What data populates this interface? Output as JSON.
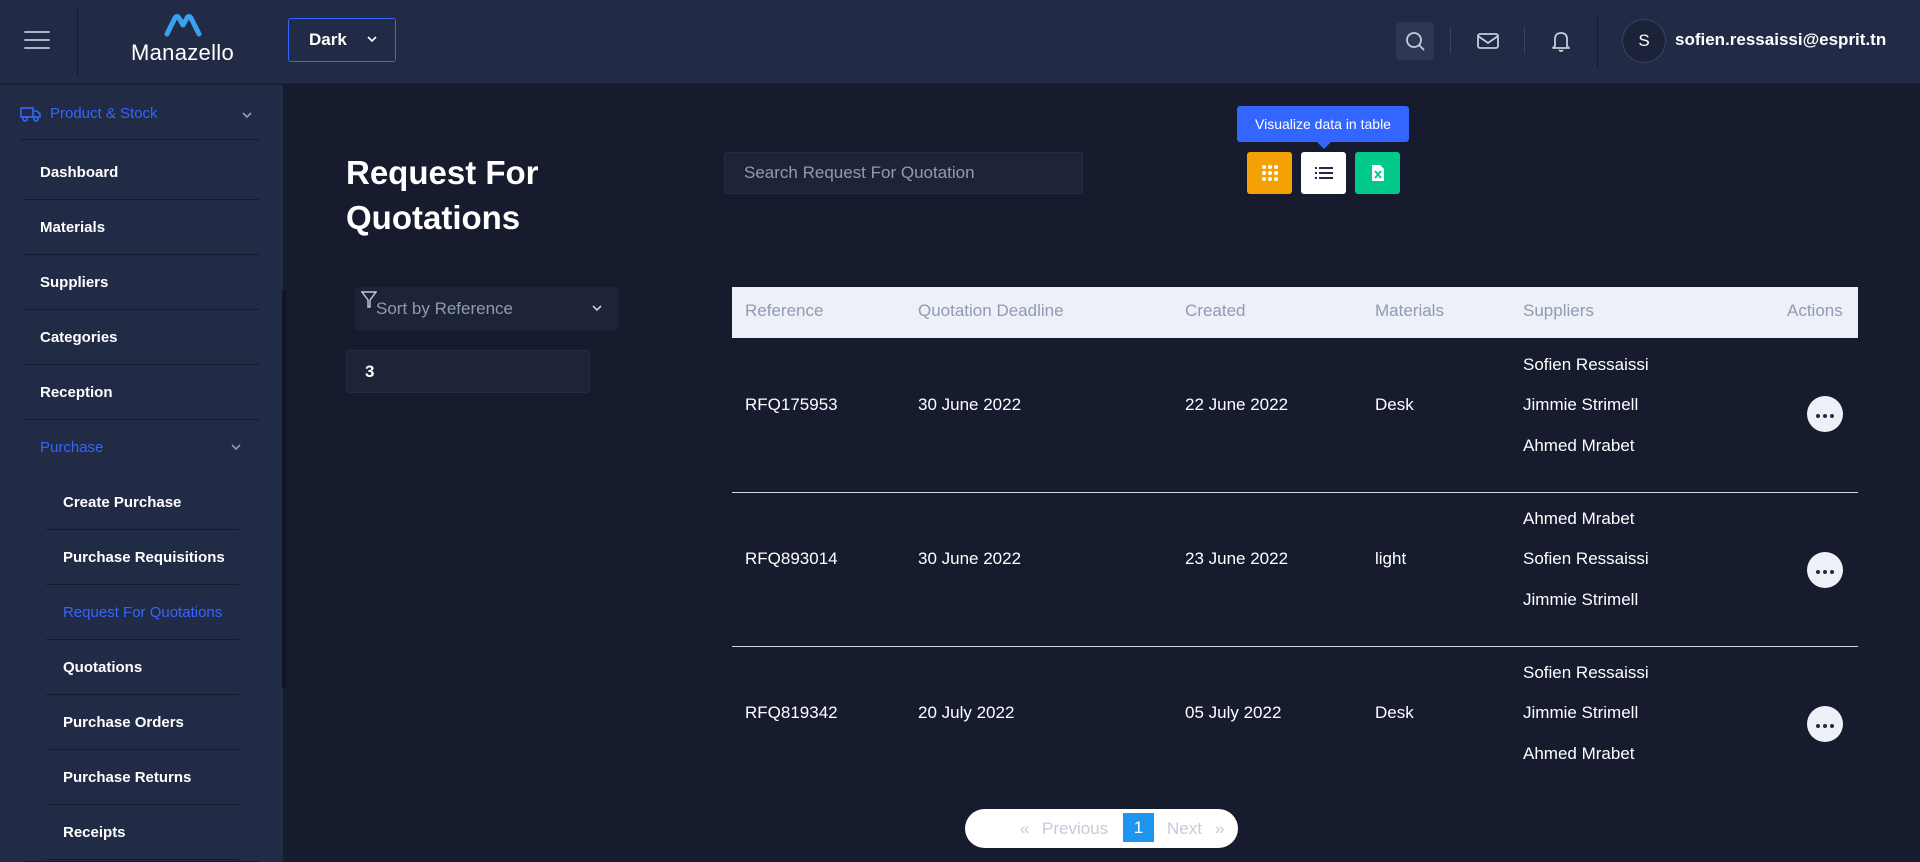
{
  "header": {
    "logo_text": "Manazello",
    "theme_selected": "Dark",
    "avatar_initial": "S",
    "user_email": "sofien.ressaissi@esprit.tn"
  },
  "sidebar": {
    "section": "Product & Stock",
    "items": [
      "Dashboard",
      "Materials",
      "Suppliers",
      "Categories",
      "Reception",
      "Purchase"
    ],
    "purchase_sub": [
      "Create Purchase",
      "Purchase Requisitions",
      "Request For Quotations",
      "Quotations",
      "Purchase Orders",
      "Purchase Returns",
      "Receipts"
    ],
    "active": "Request For Quotations"
  },
  "main": {
    "title": "Request For Quotations",
    "search_placeholder": "Search Request For Quotation",
    "tooltip": "Visualize data in table",
    "sort_label": "Sort by Reference",
    "count": "3"
  },
  "table": {
    "headers": [
      "Reference",
      "Quotation Deadline",
      "Created",
      "Materials",
      "Suppliers",
      "Actions"
    ],
    "rows": [
      {
        "reference": "RFQ175953",
        "deadline": "30 June 2022",
        "created": "22 June 2022",
        "materials": "Desk",
        "suppliers": [
          "Sofien Ressaissi",
          "Jimmie Strimell",
          "Ahmed Mrabet"
        ]
      },
      {
        "reference": "RFQ893014",
        "deadline": "30 June 2022",
        "created": "23 June 2022",
        "materials": "light",
        "suppliers": [
          "Ahmed Mrabet",
          "Sofien Ressaissi",
          "Jimmie Strimell"
        ]
      },
      {
        "reference": "RFQ819342",
        "deadline": "20 July 2022",
        "created": "05 July 2022",
        "materials": "Desk",
        "suppliers": [
          "Sofien Ressaissi",
          "Jimmie Strimell",
          "Ahmed Mrabet"
        ]
      }
    ]
  },
  "pagination": {
    "first": "«",
    "previous": "Previous",
    "current": "1",
    "next": "Next",
    "last": "»"
  },
  "colors": {
    "background": "#161b2e",
    "panel": "#222b45",
    "accent": "#3366ff",
    "grid_button": "#f5a105",
    "excel_button": "#00c98a",
    "current_page": "#1e96f0"
  },
  "icons": [
    "menu-icon",
    "logo-icon",
    "chevron-down-icon",
    "search-icon",
    "mail-icon",
    "bell-icon",
    "truck-icon",
    "grid-icon",
    "list-icon",
    "excel-icon",
    "funnel-icon",
    "more-icon"
  ]
}
